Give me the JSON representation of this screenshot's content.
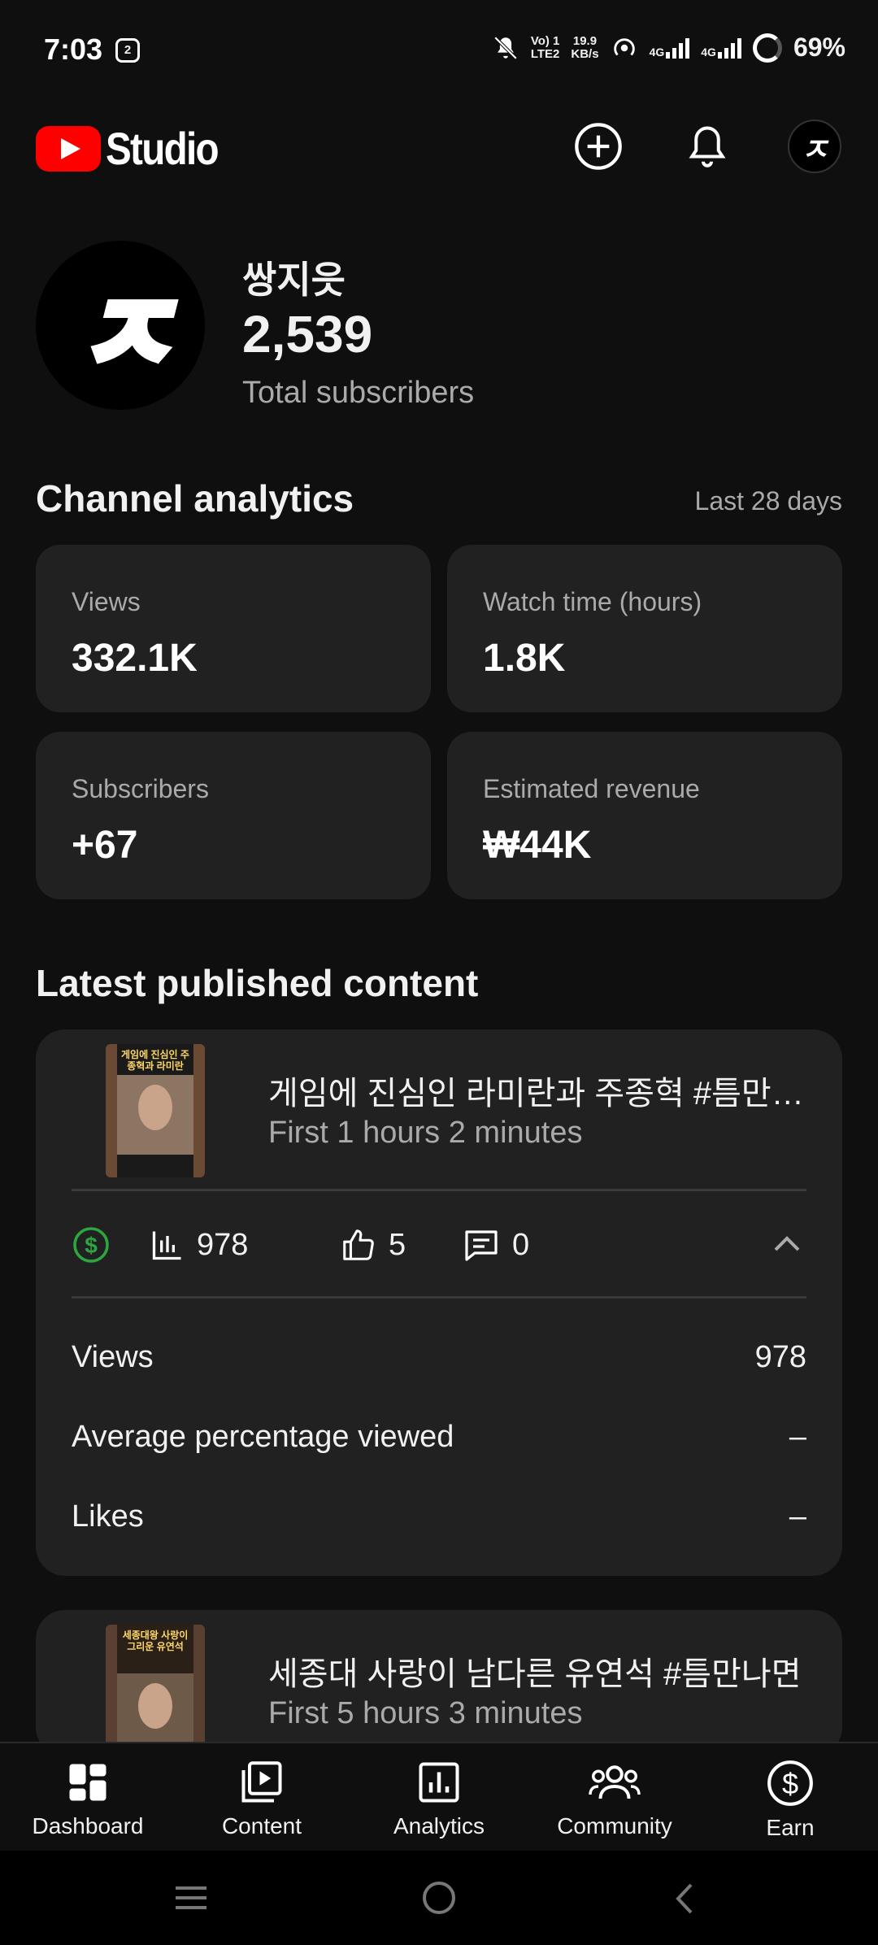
{
  "status_bar": {
    "time": "7:03",
    "network_top": "Vo) 1",
    "network_bottom": "LTE2",
    "speed_top": "19.9",
    "speed_bottom": "KB/s",
    "sig1_label": "4G",
    "sig2_label": "4G",
    "battery": "69%"
  },
  "header": {
    "logo_text": "Studio",
    "avatar_glyph": "ㅈ"
  },
  "channel": {
    "name": "쌍지읏",
    "subscribers": "2,539",
    "subscribers_label": "Total subscribers",
    "avatar_glyph": "ㅈ"
  },
  "analytics": {
    "title": "Channel analytics",
    "period": "Last 28 days",
    "cards": [
      {
        "label": "Views",
        "value": "332.1K"
      },
      {
        "label": "Watch time (hours)",
        "value": "1.8K"
      },
      {
        "label": "Subscribers",
        "value": "+67"
      },
      {
        "label": "Estimated revenue",
        "value": "₩44K"
      }
    ]
  },
  "latest": {
    "title": "Latest published content",
    "items": [
      {
        "title": "게임에 진심인 라미란과 주종혁 #틈만나면",
        "subtitle": "First 1 hours 2 minutes",
        "thumb_caption": "게임에 진심인 주종혁과 라미란",
        "views": "978",
        "likes": "5",
        "comments": "0",
        "metrics": [
          {
            "label": "Views",
            "value": "978"
          },
          {
            "label": "Average percentage viewed",
            "value": "–"
          },
          {
            "label": "Likes",
            "value": "–"
          }
        ]
      },
      {
        "title": "세종대 사랑이 남다른 유연석 #틈만나면",
        "subtitle": "First 5 hours 3 minutes",
        "thumb_caption": "세종대왕 사랑이 그리운 유연석"
      }
    ]
  },
  "bottom_nav": [
    {
      "label": "Dashboard",
      "icon": "dashboard-icon"
    },
    {
      "label": "Content",
      "icon": "content-icon"
    },
    {
      "label": "Analytics",
      "icon": "analytics-icon"
    },
    {
      "label": "Community",
      "icon": "community-icon"
    },
    {
      "label": "Earn",
      "icon": "earn-icon"
    }
  ],
  "colors": {
    "background": "#0f0f0f",
    "card": "#212121",
    "brand_red": "#ff0000",
    "monetized_green": "#2ba640"
  }
}
